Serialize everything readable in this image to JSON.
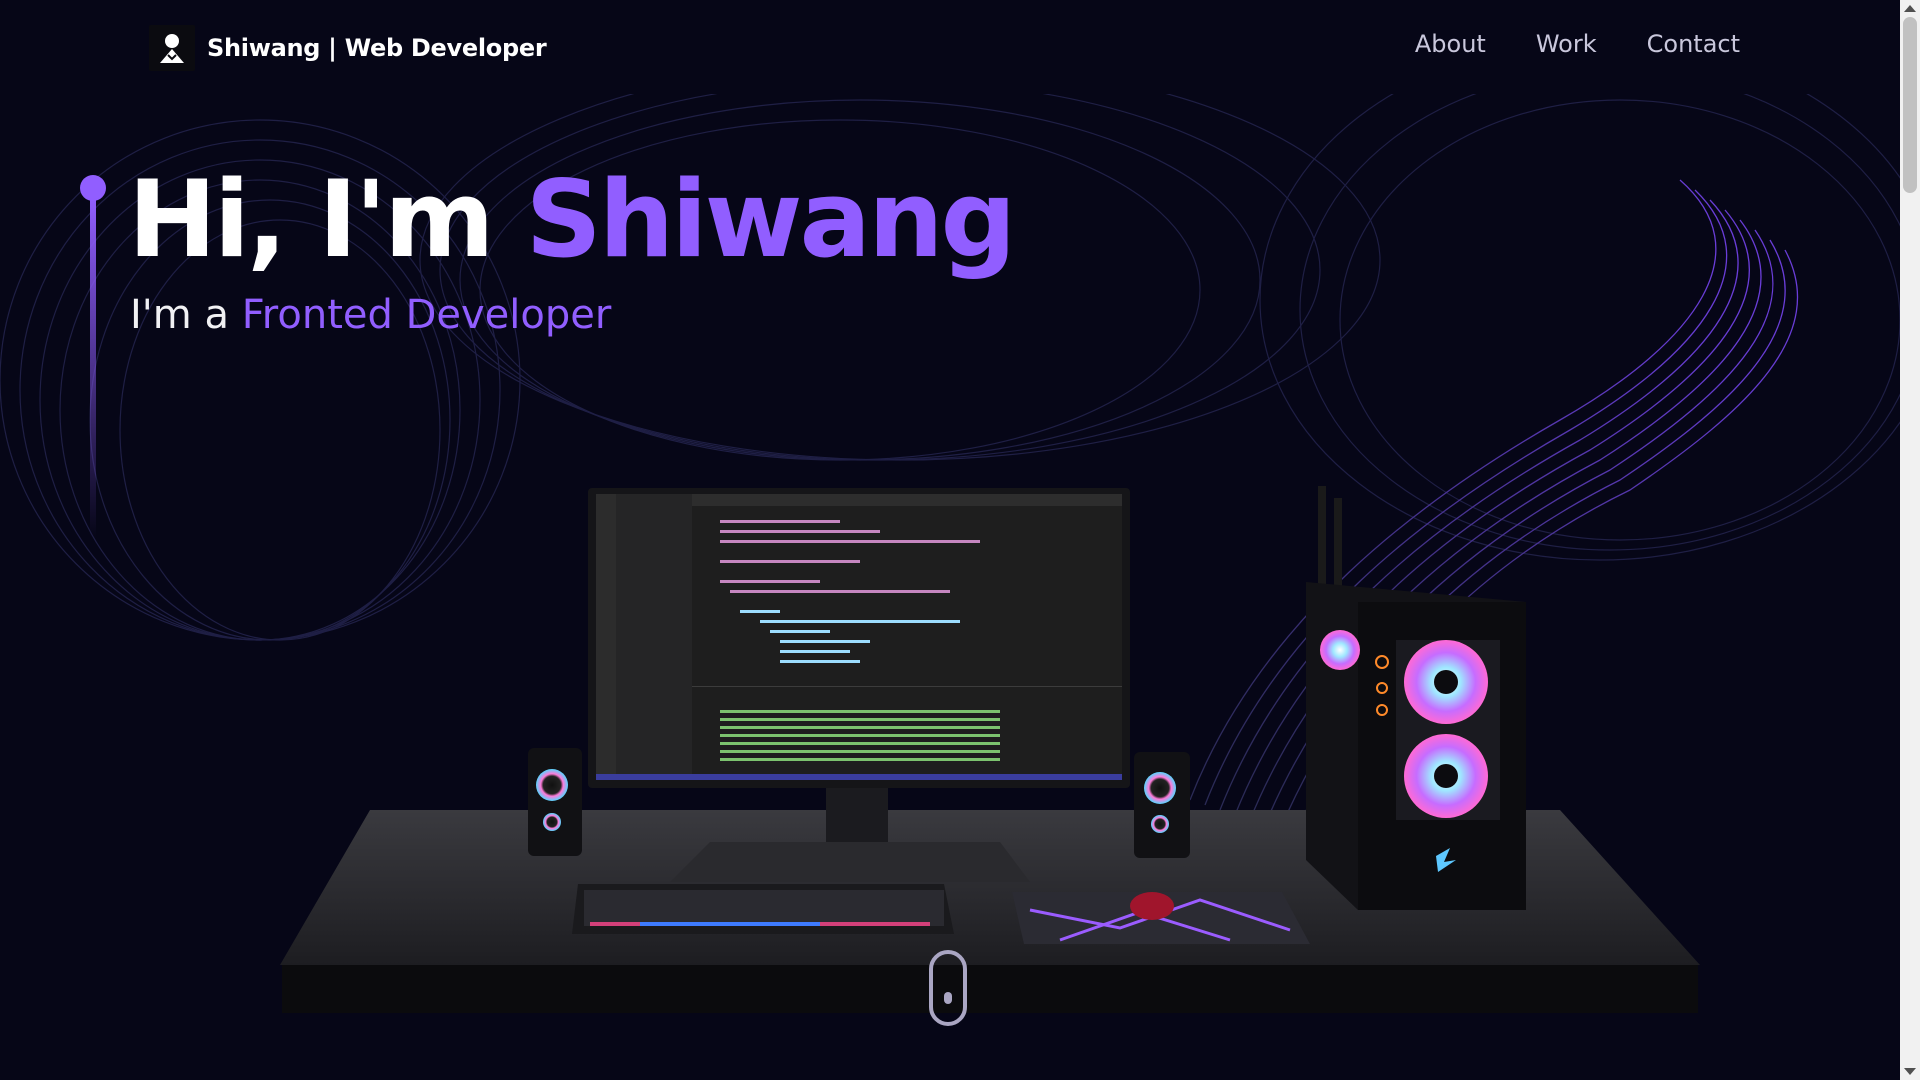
{
  "header": {
    "brand": "Shiwang  | Web Developer",
    "nav": [
      "About",
      "Work",
      "Contact"
    ]
  },
  "hero": {
    "greeting": "Hi, I'm ",
    "name": "Shiwang",
    "sub_prefix": "I'm a ",
    "sub_role": "Fronted Developer"
  },
  "colors": {
    "accent": "#915eff",
    "background": "#060617",
    "nav_text": "#c9c7dc"
  },
  "icons": {
    "logo": "user-silhouette-icon",
    "scroll": "mouse-scroll-icon"
  }
}
